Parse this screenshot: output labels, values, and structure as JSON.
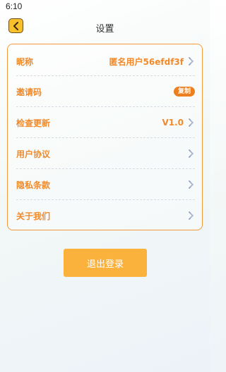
{
  "status_bar": {
    "time": "6:10"
  },
  "header": {
    "title": "设置",
    "back_icon": "chevron-left-icon"
  },
  "settings": {
    "rows": [
      {
        "label": "昵称",
        "value": "匿名用户56efdf3f",
        "icon": "chevron-right-icon"
      },
      {
        "label": "邀请码",
        "badge": "复制"
      },
      {
        "label": "检查更新",
        "value": "V1.0",
        "icon": "chevron-right-icon"
      },
      {
        "label": "用户协议",
        "icon": "chevron-right-icon"
      },
      {
        "label": "隐私条款",
        "icon": "chevron-right-icon"
      },
      {
        "label": "关于我们",
        "icon": "chevron-right-icon"
      }
    ]
  },
  "logout": {
    "label": "退出登录"
  },
  "colors": {
    "accent": "#f08a2a",
    "button": "#fbb23d",
    "back_button": "#f8c12b"
  }
}
